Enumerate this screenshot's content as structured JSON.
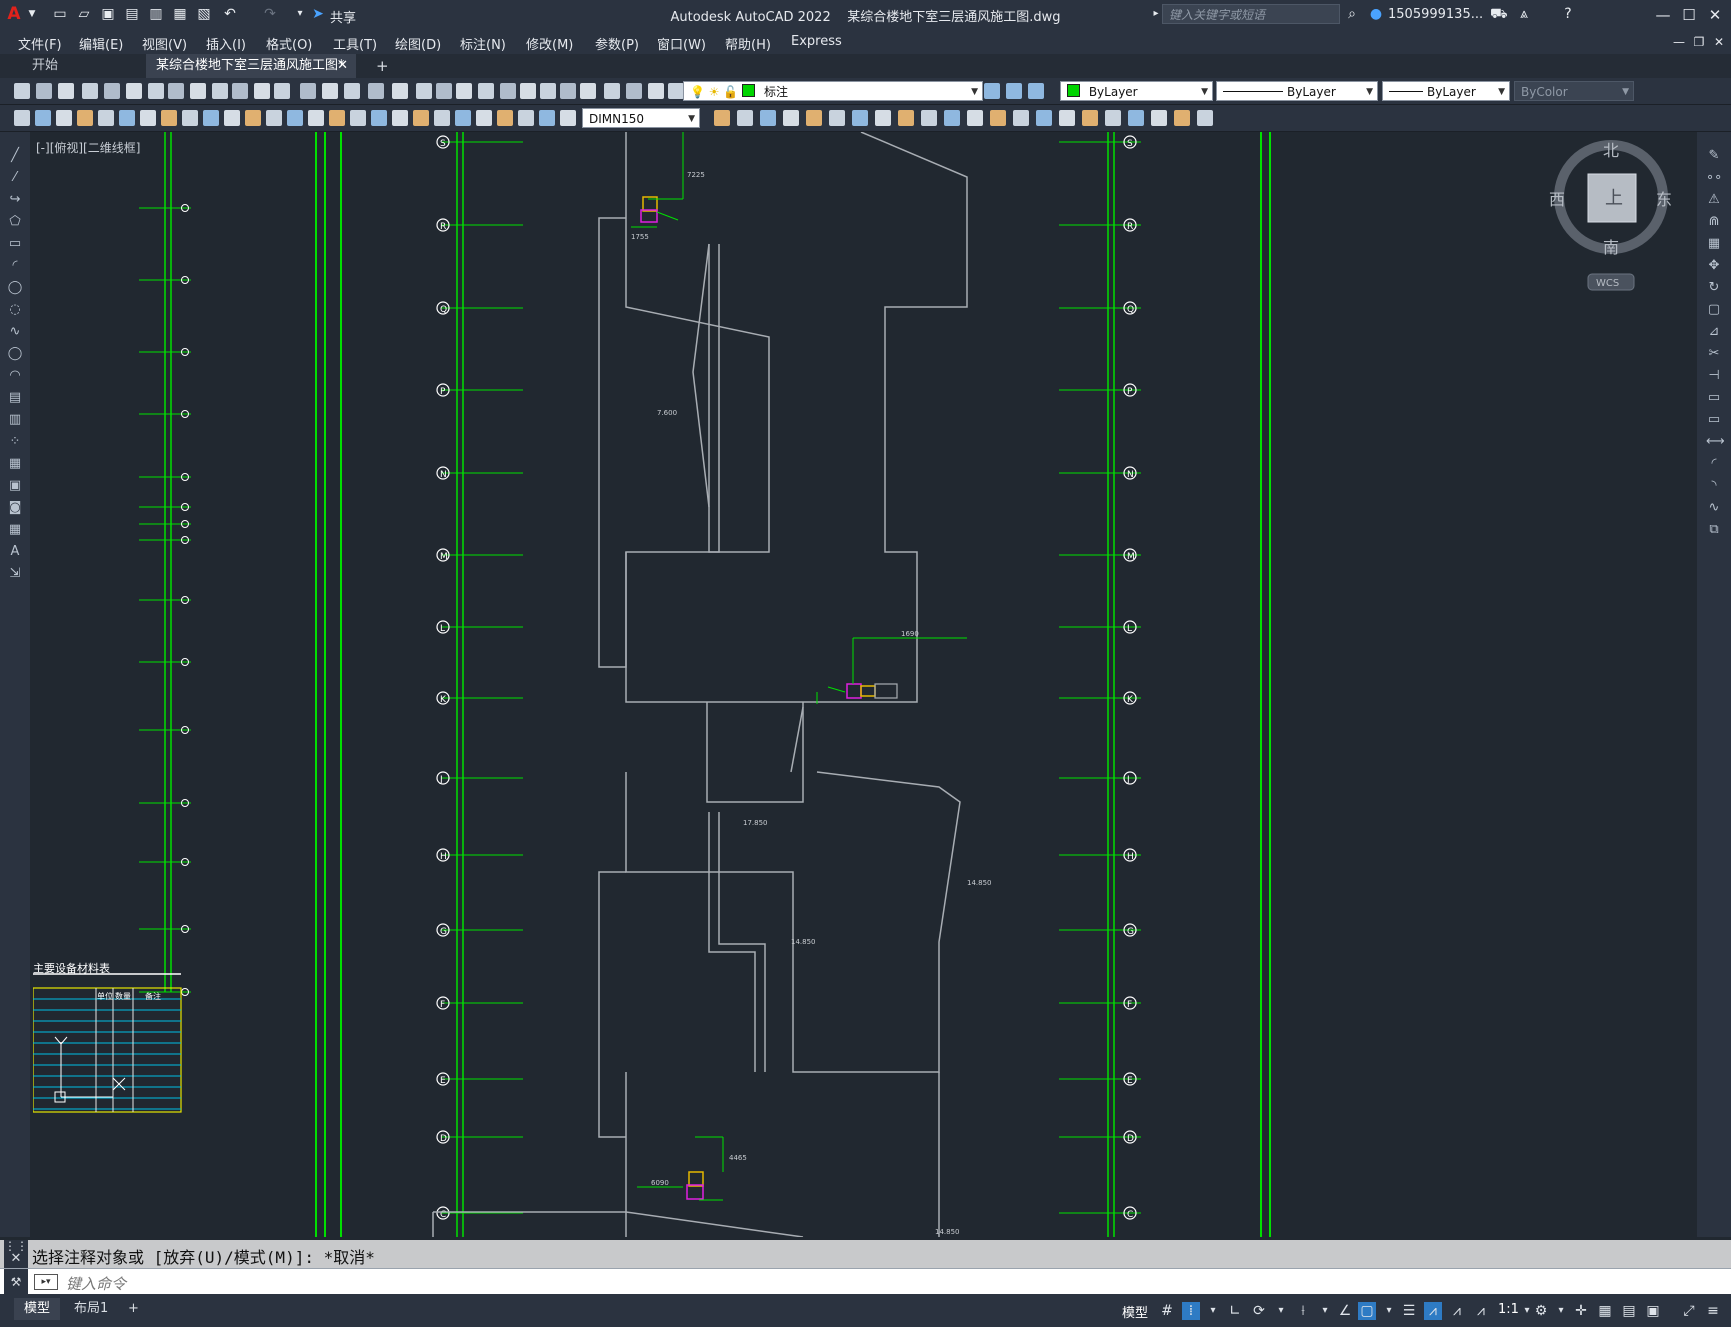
{
  "app": {
    "title": "Autodesk AutoCAD 2022",
    "file": "某综合楼地下室三层通风施工图.dwg"
  },
  "quick_access": {
    "share_label": "共享"
  },
  "search": {
    "placeholder": "键入关键字或短语"
  },
  "user": {
    "name": "1505999135..."
  },
  "menus": [
    "文件(F)",
    "编辑(E)",
    "视图(V)",
    "插入(I)",
    "格式(O)",
    "工具(T)",
    "绘图(D)",
    "标注(N)",
    "修改(M)",
    "参数(P)",
    "窗口(W)",
    "帮助(H)",
    "Express"
  ],
  "tabs": {
    "start": "开始",
    "active": "某综合楼地下室三层通风施工图*",
    "add": "+"
  },
  "layer": {
    "current": "标注",
    "color_name": "ByLayer",
    "linetype": "ByLayer",
    "lineweight": "ByLayer",
    "plotstyle": "ByColor"
  },
  "dimstyle": {
    "current": "DIMN150"
  },
  "viewport": {
    "label": "[-][俯视][二维线框]"
  },
  "viewcube": {
    "north": "北",
    "south": "南",
    "east": "东",
    "west": "西",
    "top": "上",
    "wcs": "WCS"
  },
  "drawing": {
    "grid_left": [
      "S",
      "R",
      "Q",
      "P",
      "N",
      "M",
      "L",
      "K",
      "J",
      "H",
      "G",
      "F",
      "E",
      "D",
      "C"
    ],
    "elev_labels": [
      "7.600",
      "17.850",
      "14.850",
      "14.850",
      "14.850"
    ],
    "dims": [
      "1690",
      "1755",
      "7225",
      "4465",
      "6090"
    ],
    "legend_title": "主要设备材料表",
    "legend_cols": [
      "单位",
      "数量",
      "备注"
    ]
  },
  "command": {
    "history": "选择注释对象或 [放弃(U)/模式(M)]: *取消*",
    "placeholder": "键入命令"
  },
  "status": {
    "model_tab": "模型",
    "layout_tab": "布局1",
    "add_tab": "+",
    "model_btn": "模型",
    "scale": "1:1"
  },
  "colors": {
    "accent": "#0078d7",
    "grid_green": "#00ff00",
    "background": "#212830"
  }
}
